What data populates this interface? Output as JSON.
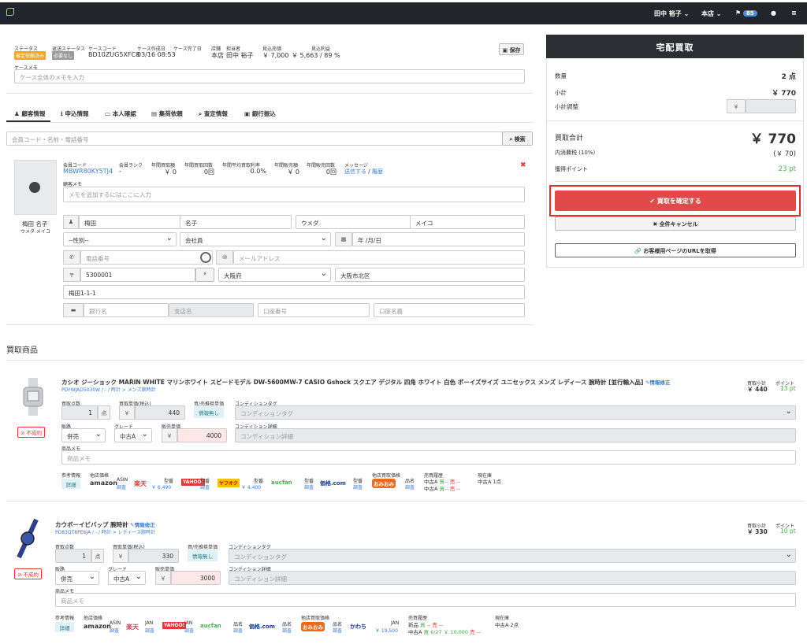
{
  "topbar": {
    "user": "田中 裕子",
    "store": "本店",
    "notif_count": "85"
  },
  "case": {
    "labels": {
      "status": "ステータス",
      "ship_status": "返送ステータス",
      "case_code": "ケースコード",
      "created": "ケース作成日",
      "completed": "ケース完了日",
      "store": "店舗",
      "staff": "担当者",
      "estimate": "見込売価",
      "profit": "見込利益",
      "memo": "ケースメモ"
    },
    "status_tag": "審定依頼済み",
    "ship_tag": "必要なし",
    "case_code": "BD10ZUG5XFC8",
    "created": "03/16 08:53",
    "completed": "-",
    "store": "本店",
    "staff": "田中 裕子",
    "estimate": "￥ 7,000",
    "profit": "￥ 5,663 / 89 %",
    "save_label": "保存",
    "memo_placeholder": "ケース全体のメモを入力"
  },
  "tabs": [
    "顧客情報",
    "申込情報",
    "本人確認",
    "集荷依頼",
    "査定情報",
    "銀行振込"
  ],
  "search": {
    "placeholder": "会員コード・名前・電話番号",
    "button": "検索"
  },
  "customer": {
    "name": "梅田 名子",
    "kana": "ウメダ メイコ",
    "labels": {
      "code": "会員コード",
      "rank": "会員ランク",
      "buy_count": "年間買取額",
      "buy_times": "年間買取回数",
      "avg_rate": "年間平均買取利率",
      "sales": "年間販売額",
      "sales_times": "年間販売回数",
      "message": "メッセージ",
      "memo": "顧客メモ"
    },
    "code": "MBWR80KY5TJ4",
    "rank": "-",
    "buy_amount": "￥ 0",
    "buy_times": "0回",
    "avg_rate": "0.0%",
    "sales": "￥ 0",
    "sales_times": "0回",
    "message_send": "送信する",
    "message_sep": "/",
    "message_history": "履歴",
    "memo_placeholder": "メモを追加するにはここに入力",
    "last_name": "梅田",
    "first_name": "名子",
    "last_kana": "ウメダ",
    "first_kana": "メイコ",
    "gender": "--性別--",
    "member_type": "会社員",
    "birth": "年 /月/日",
    "phone_placeholder": "電話番号",
    "email_placeholder": "メールアドレス",
    "zip": "5300001",
    "pref": "大阪府",
    "city": "大阪市北区",
    "address": "梅田1-1-1",
    "bank": "銀行名",
    "branch": "支店名",
    "account": "口座番号",
    "account_name": "口座名義"
  },
  "summary": {
    "title": "宅配買取",
    "qty_label": "数量",
    "qty": "2 点",
    "subtotal_label": "小計",
    "subtotal": "￥ 770",
    "adjust_label": "小計調整",
    "adjust_prefix": "￥",
    "total_label": "買取合計",
    "total": "￥ 770",
    "tax_label": "内消費税 (10%)",
    "tax": "(￥ 70)",
    "points_label": "獲得ポイント",
    "points": "23 pt",
    "confirm": "買取を確定する",
    "cancel": "全件キャンセル",
    "url": "お客様用ページのURLを取得"
  },
  "products_heading": "買取商品",
  "common_labels": {
    "qty": "買取点数",
    "unit_price": "買取単価(税込)",
    "recommended": "買/売推奨単価",
    "cond_tag": "コンディションタグ",
    "channel": "販路",
    "grade": "グレード",
    "sell_price": "販売単価",
    "cond_detail": "コンディション詳細",
    "memo": "商品メモ",
    "ref": "参考情報",
    "other_price": "他店価格",
    "other_buy": "他店買取価格",
    "history": "売買履歴",
    "stock": "現在庫",
    "subtotal": "買取小計",
    "point": "ポイント",
    "unit": "点",
    "yen": "￥",
    "no_info": "情報無し",
    "edit": "情報修正",
    "detail": "詳細",
    "inquiry": "調査",
    "fail": "不成約",
    "cond_tag_ph": "コンディションタグ",
    "cond_detail_ph": "コンディション詳細",
    "memo_ph": "商品メモ",
    "asin": "ASIN",
    "model": "型番",
    "jan": "JAN",
    "name_lbl": "品名"
  },
  "products": [
    {
      "title": "カシオ ジーショック MARIN WHITE マリンホワイト スピードモデル DW-5600MW-7 CASIO Gshock スクエア デジタル 四角 ホワイト 白色 ボーイズサイズ ユニセックス メンズ レディース 腕時計 [並行輸入品]",
      "code_path": "PDYWJAD5030W / - / 時計 > メンズ腕時計",
      "qty": "1",
      "unit_price": "440",
      "channel": "併売",
      "grade": "中古A",
      "sell_price": "4000",
      "subtotal": "￥ 440",
      "point": "13 pt",
      "rakuten_price": "￥ 6,490",
      "yahoo_price": "￥ 4,400",
      "history_1": "中古A",
      "history_1_b": "買",
      "history_1_s": "-- 売 --",
      "history_2": "中古A",
      "history_2_b": "買",
      "history_2_s": "-- 売 --",
      "stock": "中古A 1点"
    },
    {
      "title": "カウボーイビバップ 腕時計",
      "code_path": "PD83QT8PE6JA / - / 時計 > レディース腕時計",
      "qty": "1",
      "unit_price": "330",
      "channel": "併売",
      "grade": "中古A",
      "sell_price": "3000",
      "subtotal": "￥ 330",
      "point": "10 pt",
      "kawachi_price": "￥ 19,500",
      "history_1": "新品",
      "history_1_b": "買",
      "history_1_s": "-- 売 --",
      "history_2": "中古A",
      "history_2_b": "買 6/27 ￥ 10,000",
      "history_2_s": "売 --",
      "stock": "中古A 2点"
    }
  ],
  "shops": {
    "amazon": "amazon",
    "rakuten": "楽天",
    "yahoo": "YAHOO!",
    "yahuoku": "ヤフオク",
    "aucfan": "aucfan",
    "kakaku": "価格.com",
    "omiomi": "おみおみ",
    "kawachi": "かわち"
  },
  "colors": {
    "confirm": "#e24a4a",
    "status_tag": "#f5a623",
    "ship_tag": "#9b9b9b",
    "topbar": "#222529",
    "panel_head": "#2b2e33"
  }
}
